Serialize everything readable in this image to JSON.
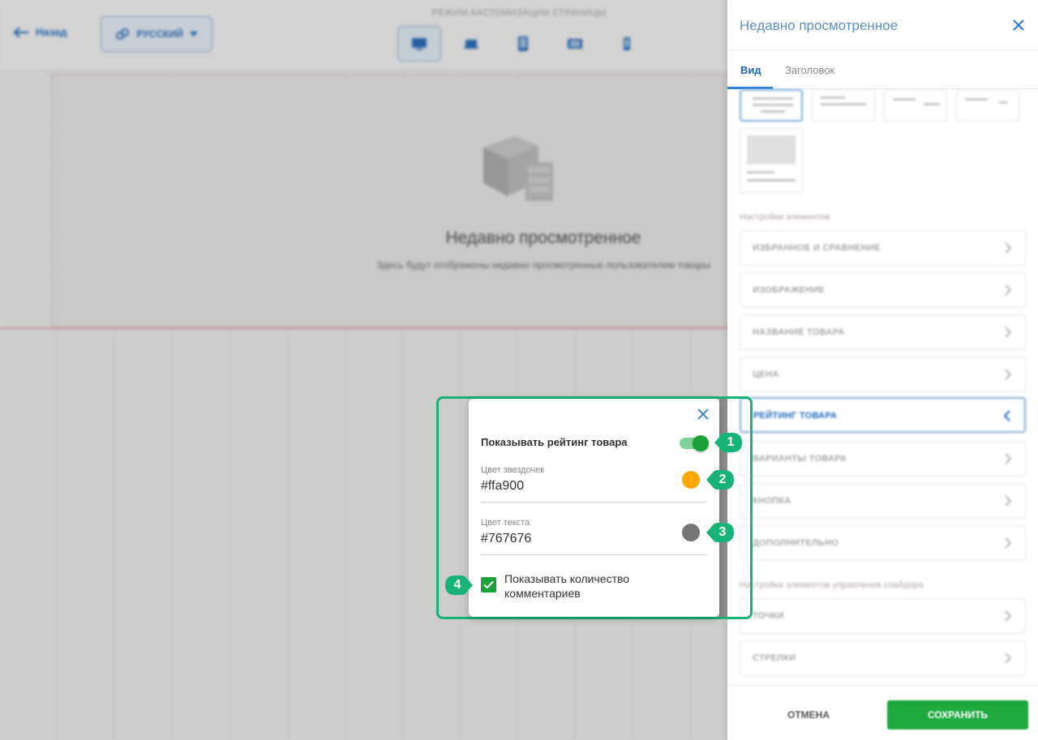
{
  "topbar": {
    "back_label": "Назад",
    "language_label": "РУССКИЙ",
    "mode_label": "РЕЖИМ КАСТОМИЗАЦИИ СТРАНИЦЫ",
    "devices": [
      "desktop-icon",
      "laptop-icon",
      "tablet-icon",
      "tablet-landscape-icon",
      "phone-icon"
    ]
  },
  "preview": {
    "title": "Недавно просмотренное",
    "subtitle": "Здесь будут отображены недавно просмотренные пользователем товары"
  },
  "panel": {
    "title": "Недавно просмотренное",
    "tabs": [
      "Вид",
      "Заголовок"
    ],
    "elements_label": "Настройки элементов",
    "items": [
      "ИЗБРАННОЕ И СРАВНЕНИЕ",
      "ИЗОБРАЖЕНИЕ",
      "НАЗВАНИЕ ТОВАРА",
      "ЦЕНА",
      "РЕЙТИНГ ТОВАРА",
      "ВАРИАНТЫ ТОВАРА",
      "КНОПКА",
      "ДОПОЛНИТЕЛЬНО"
    ],
    "slider_label": "Настройки элементов управления слайдера",
    "slider_items": [
      "ТОЧКИ",
      "СТРЕЛКИ"
    ],
    "cancel_label": "ОТМЕНА",
    "save_label": "СОХРАНИТЬ"
  },
  "popover": {
    "toggle_label": "Показывать рейтинг товара",
    "toggle_on": true,
    "star_color_label": "Цвет звездочек",
    "star_color_value": "#ffa900",
    "text_color_label": "Цвет текста",
    "text_color_value": "#767676",
    "checkbox_label": "Показывать количество комментариев",
    "checkbox_checked": true
  },
  "callouts": [
    "1",
    "2",
    "3",
    "4"
  ],
  "colors": {
    "accent_green": "#1aa13a",
    "highlight": "#17b377",
    "link_blue": "#1e66b8",
    "star": "#ffa900",
    "text_gray": "#767676"
  }
}
